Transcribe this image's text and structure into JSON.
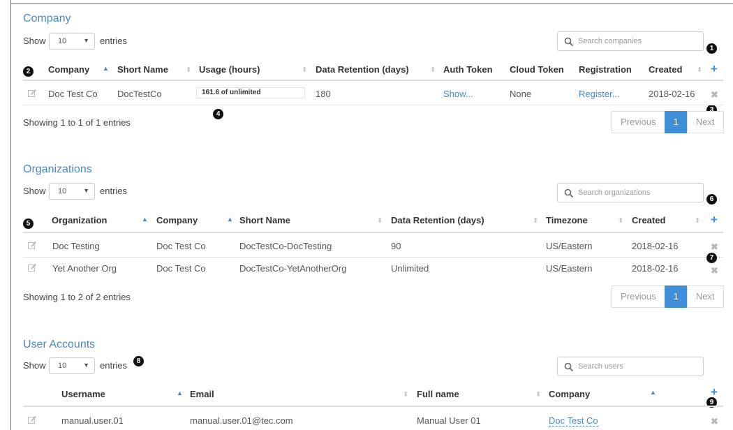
{
  "sections": {
    "company": {
      "title": "Company",
      "show_label": "Show",
      "entries_value": "10",
      "entries_label": "entries",
      "search_placeholder": "Search companies",
      "headers": [
        "Company",
        "Short Name",
        "Usage (hours)",
        "Data Retention (days)",
        "Auth Token",
        "Cloud Token",
        "Registration",
        "Created"
      ],
      "rows": [
        {
          "company": "Doc Test Co",
          "short_name": "DocTestCo",
          "usage": "161.6 of unlimited",
          "retention": "180",
          "auth_token": "Show...",
          "cloud_token": "None",
          "registration": "Register...",
          "created": "2018-02-16"
        }
      ],
      "info": "Showing 1 to 1 of 1 entries",
      "pager": {
        "previous": "Previous",
        "page": "1",
        "next": "Next"
      }
    },
    "organizations": {
      "title": "Organizations",
      "show_label": "Show",
      "entries_value": "10",
      "entries_label": "entries",
      "search_placeholder": "Search organizations",
      "headers": [
        "Organization",
        "Company",
        "Short Name",
        "Data Retention (days)",
        "Timezone",
        "Created"
      ],
      "rows": [
        {
          "organization": "Doc Testing",
          "company": "Doc Test Co",
          "short_name": "DocTestCo-DocTesting",
          "retention": "90",
          "timezone": "US/Eastern",
          "created": "2018-02-16"
        },
        {
          "organization": "Yet Another Org",
          "company": "Doc Test Co",
          "short_name": "DocTestCo-YetAnotherOrg",
          "retention": "Unlimited",
          "timezone": "US/Eastern",
          "created": "2018-02-16"
        }
      ],
      "info": "Showing 1 to 2 of 2 entries",
      "pager": {
        "previous": "Previous",
        "page": "1",
        "next": "Next"
      }
    },
    "users": {
      "title": "User Accounts",
      "show_label": "Show",
      "entries_value": "10",
      "entries_label": "entries",
      "search_placeholder": "Search users",
      "headers": [
        "Username",
        "Email",
        "Full name",
        "Company"
      ],
      "rows": [
        {
          "username": "manual.user.01",
          "email": "manual.user.01@tec.com",
          "full_name": "Manual User 01",
          "company": "Doc Test Co"
        }
      ]
    }
  },
  "callouts": [
    "1",
    "2",
    "3",
    "4",
    "5",
    "6",
    "7",
    "8",
    "9"
  ],
  "icons": {
    "edit": "edit-icon",
    "delete": "delete-icon",
    "add": "add-icon",
    "search": "search-icon"
  },
  "symbols": {
    "plus": "+",
    "x": "✖",
    "caret": "▼",
    "sort_up": "▲",
    "sort_both": "⬍"
  },
  "colors": {
    "accent": "#4a88c5",
    "button_blue": "#3f8fd8",
    "header_rule": "#dddddd"
  }
}
